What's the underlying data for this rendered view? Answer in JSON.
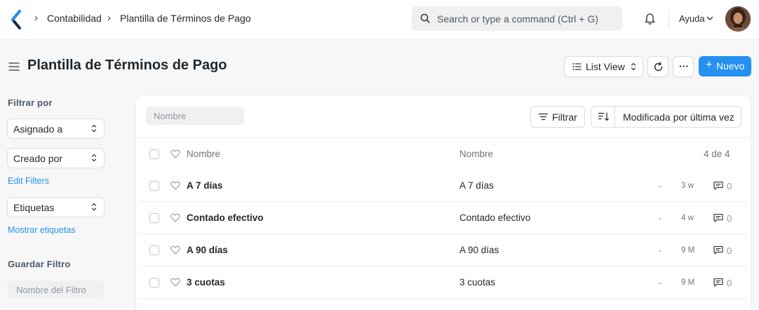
{
  "navbar": {
    "breadcrumbs": [
      "Contabilidad",
      "Plantilla de Términos de Pago"
    ],
    "search_placeholder": "Search or type a command (Ctrl + G)",
    "help_label": "Ayuda"
  },
  "page": {
    "title": "Plantilla de Términos de Pago",
    "list_view_label": "List View",
    "more_label": "···",
    "new_label": "Nuevo"
  },
  "sidebar": {
    "filter_by_label": "Filtrar por",
    "assigned_to": "Asignado a",
    "created_by": "Creado por",
    "edit_filters": "Edit Filters",
    "tags": "Etiquetas",
    "show_tags": "Mostrar etiquetas",
    "save_filter_label": "Guardar Filtro",
    "filter_name_placeholder": "Nombre del Filtro"
  },
  "list": {
    "name_filter_placeholder": "Nombre",
    "filter_button": "Filtrar",
    "sort_field": "Modificada por última vez",
    "columns": {
      "title": "Nombre",
      "name": "Nombre"
    },
    "count": "4 de 4",
    "rows": [
      {
        "title": "A 7 días",
        "name": "A 7 días",
        "status": "-",
        "modified": "3 w",
        "comments": "0"
      },
      {
        "title": "Contado efectivo",
        "name": "Contado efectivo",
        "status": "-",
        "modified": "4 w",
        "comments": "0"
      },
      {
        "title": "A 90 días",
        "name": "A 90 días",
        "status": "-",
        "modified": "9 M",
        "comments": "0"
      },
      {
        "title": "3 cuotas",
        "name": "3 cuotas",
        "status": "-",
        "modified": "9 M",
        "comments": "0"
      }
    ]
  },
  "colors": {
    "primary": "#2490ef",
    "text": "#1f272e",
    "muted": "#6c7680",
    "background": "#f7f7f7"
  }
}
